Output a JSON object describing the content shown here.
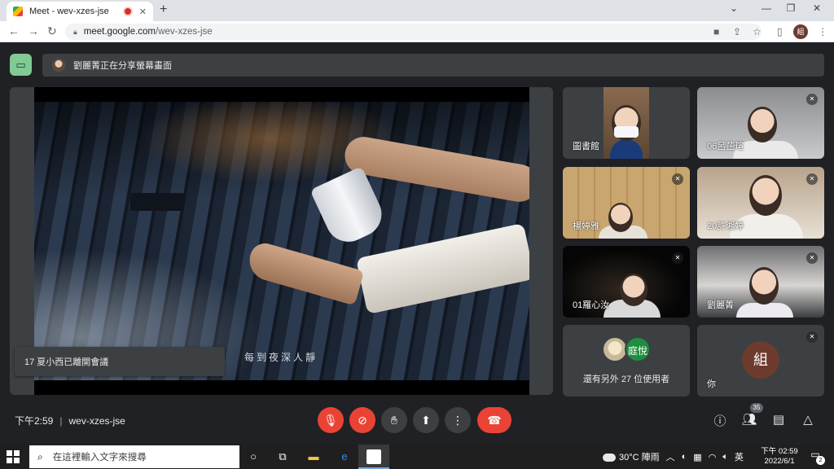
{
  "browser": {
    "tab_title": "Meet - wev-xzes-jse",
    "tab_close": "✕",
    "new_tab": "+",
    "url_host": "meet.google.com",
    "url_path": "/wev-xzes-jse",
    "profile_initial": "組",
    "window_controls": [
      "⌄",
      "—",
      "❐",
      "✕"
    ]
  },
  "meet": {
    "presenting_banner": "劉麗菁正在分享螢幕畫面",
    "subtitle": "每到夜深人靜",
    "toast": "17 夏小西已離開會議",
    "tiles": [
      {
        "name": "圖書館",
        "muted": false
      },
      {
        "name": "06呂芷瑄",
        "muted": true
      },
      {
        "name": "楊婷雅",
        "muted": true
      },
      {
        "name": "20許湘婷",
        "muted": true
      },
      {
        "name": "01羅心汝",
        "muted": true
      },
      {
        "name": "劉麗菁",
        "muted": true
      }
    ],
    "others": {
      "avatar_label": "庭悅",
      "label": "還有另外 27 位使用者"
    },
    "self": {
      "initial": "組",
      "name": "你"
    },
    "time": "下午2:59",
    "meeting_code": "wev-xzes-jse",
    "participant_count": "35"
  },
  "taskbar": {
    "search_placeholder": "在這裡輸入文字來搜尋",
    "weather": "30°C 陣雨",
    "ime": "英",
    "clock_time": "下午 02:59",
    "clock_date": "2022/6/1",
    "notification_count": "2"
  },
  "colors": {
    "meet_bg": "#202124",
    "tile_bg": "#3c4043",
    "danger": "#ea4335",
    "present_green": "#81c995",
    "avatar_brown": "#6d3b2e"
  }
}
